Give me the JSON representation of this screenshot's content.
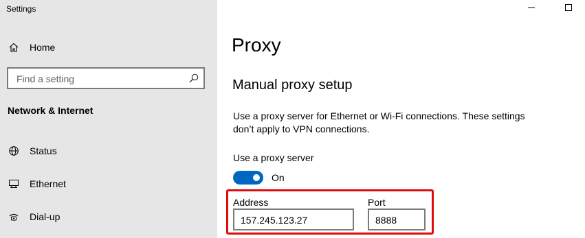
{
  "window": {
    "title": "Settings"
  },
  "sidebar": {
    "home_label": "Home",
    "search": {
      "placeholder": "Find a setting",
      "value": ""
    },
    "section_title": "Network & Internet",
    "items": [
      {
        "label": "Status",
        "icon": "globe-icon"
      },
      {
        "label": "Ethernet",
        "icon": "ethernet-icon"
      },
      {
        "label": "Dial-up",
        "icon": "dialup-icon"
      }
    ]
  },
  "main": {
    "page_title": "Proxy",
    "section_title": "Manual proxy setup",
    "description": "Use a proxy server for Ethernet or Wi-Fi connections. These settings don’t apply to VPN connections.",
    "use_proxy_label": "Use a proxy server",
    "toggle": {
      "state": "On",
      "on": true
    },
    "address": {
      "label": "Address",
      "value": "157.245.123.27"
    },
    "port": {
      "label": "Port",
      "value": "8888"
    }
  },
  "colors": {
    "accent": "#0067c0",
    "highlight_border": "#e10a0a",
    "sidebar_bg": "#e6e6e6"
  }
}
